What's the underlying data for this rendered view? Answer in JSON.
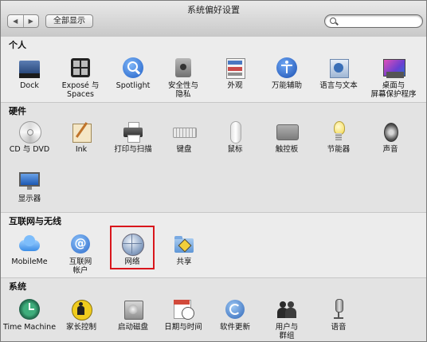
{
  "window": {
    "title": "系统偏好设置"
  },
  "toolbar": {
    "back": "◀",
    "forward": "▶",
    "show_all": "全部显示",
    "search_placeholder": ""
  },
  "sections": [
    {
      "title": "个人",
      "items": [
        {
          "label": "Dock",
          "icon": "dock-icon"
        },
        {
          "label": "Exposé 与\nSpaces",
          "icon": "expose-icon"
        },
        {
          "label": "Spotlight",
          "icon": "spotlight-icon"
        },
        {
          "label": "安全性与\n隐私",
          "icon": "security-icon"
        },
        {
          "label": "外观",
          "icon": "appearance-icon"
        },
        {
          "label": "万能辅助",
          "icon": "universal-access-icon"
        },
        {
          "label": "语言与文本",
          "icon": "language-icon"
        },
        {
          "label": "桌面与\n屏幕保护程序",
          "icon": "desktop-icon"
        }
      ]
    },
    {
      "title": "硬件",
      "items": [
        {
          "label": "CD 与 DVD",
          "icon": "cd-dvd-icon"
        },
        {
          "label": "Ink",
          "icon": "ink-icon"
        },
        {
          "label": "打印与扫描",
          "icon": "printer-icon"
        },
        {
          "label": "键盘",
          "icon": "keyboard-icon"
        },
        {
          "label": "鼠标",
          "icon": "mouse-icon"
        },
        {
          "label": "触控板",
          "icon": "trackpad-icon"
        },
        {
          "label": "节能器",
          "icon": "energy-saver-icon"
        },
        {
          "label": "声音",
          "icon": "sound-icon"
        },
        {
          "label": "显示器",
          "icon": "display-icon"
        }
      ]
    },
    {
      "title": "互联网与无线",
      "items": [
        {
          "label": "MobileMe",
          "icon": "mobileme-icon"
        },
        {
          "label": "互联网\n帐户",
          "icon": "internet-accounts-icon"
        },
        {
          "label": "网络",
          "icon": "network-icon"
        },
        {
          "label": "共享",
          "icon": "sharing-icon"
        }
      ]
    },
    {
      "title": "系统",
      "items": [
        {
          "label": "Time Machine",
          "icon": "time-machine-icon"
        },
        {
          "label": "家长控制",
          "icon": "parental-controls-icon"
        },
        {
          "label": "启动磁盘",
          "icon": "startup-disk-icon"
        },
        {
          "label": "日期与时间",
          "icon": "date-time-icon"
        },
        {
          "label": "软件更新",
          "icon": "software-update-icon"
        },
        {
          "label": "用户与\n群组",
          "icon": "users-groups-icon"
        },
        {
          "label": "语音",
          "icon": "speech-icon"
        }
      ]
    }
  ],
  "colors": {
    "highlight": "#d9161c"
  }
}
